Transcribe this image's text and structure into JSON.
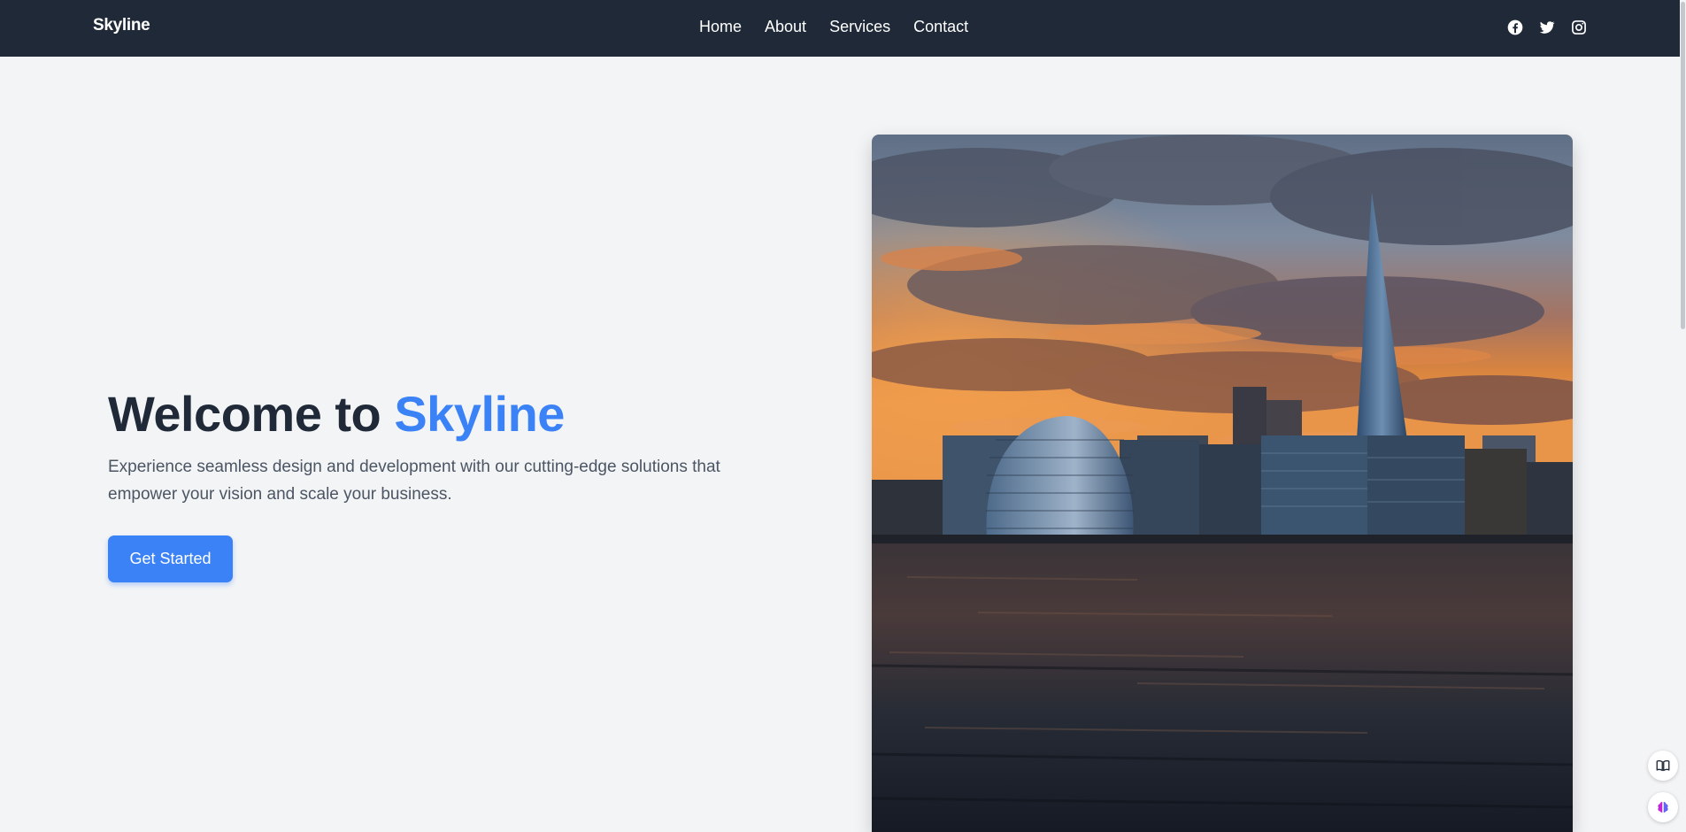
{
  "nav": {
    "brand": "Skyline",
    "links": [
      "Home",
      "About",
      "Services",
      "Contact"
    ],
    "social_icons": [
      "facebook-icon",
      "twitter-icon",
      "instagram-icon"
    ]
  },
  "hero": {
    "title_prefix": "Welcome to ",
    "title_accent": "Skyline",
    "subtitle": "Experience seamless design and development with our cutting-edge solutions that empower your vision and scale your business.",
    "cta_label": "Get Started",
    "image_alt": "London skyline at sunset with City Hall and The Shard across the river"
  },
  "colors": {
    "navbar": "#1f2937",
    "accent": "#3b82f6",
    "background": "#f3f4f6",
    "title": "#1f2937",
    "subtitle": "#4b5563"
  },
  "floating_buttons": [
    "book-icon",
    "brain-icon"
  ]
}
